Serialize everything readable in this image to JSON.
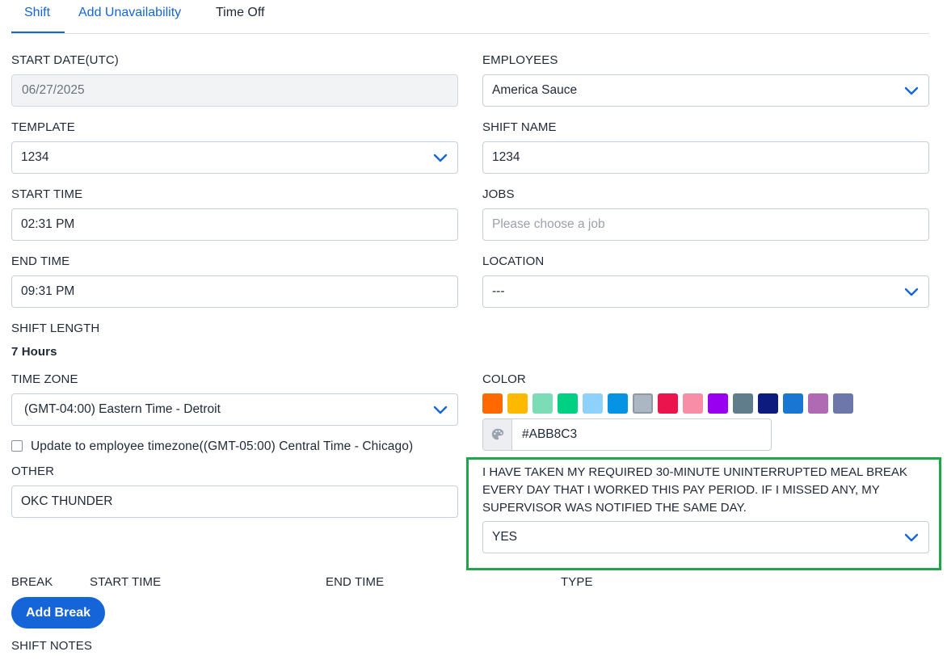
{
  "tabs": [
    {
      "label": "Shift",
      "active": true
    },
    {
      "label": "Add Unavailability",
      "active": false
    },
    {
      "label": "Time Off",
      "active": false
    }
  ],
  "form": {
    "start_date": {
      "label": "START DATE(UTC)",
      "value": "06/27/2025"
    },
    "employees": {
      "label": "EMPLOYEES",
      "value": "America Sauce"
    },
    "template": {
      "label": "TEMPLATE",
      "value": "1234"
    },
    "shift_name": {
      "label": "SHIFT NAME",
      "value": "1234"
    },
    "start_time": {
      "label": "START TIME",
      "value": "02:31 PM"
    },
    "jobs": {
      "label": "JOBS",
      "placeholder": "Please choose a job"
    },
    "end_time": {
      "label": "END TIME",
      "value": "09:31 PM"
    },
    "location": {
      "label": "LOCATION",
      "value": "---"
    },
    "shift_length": {
      "label": "SHIFT LENGTH",
      "value": "7 Hours"
    },
    "time_zone": {
      "label": "TIME ZONE",
      "value": "(GMT-04:00) Eastern Time - Detroit"
    },
    "update_timezone": {
      "label": "Update to employee timezone((GMT-05:00) Central Time - Chicago)",
      "checked": false
    },
    "color": {
      "label": "COLOR",
      "value": "#ABB8C3",
      "selected": "#ABB8C3",
      "swatches": [
        "#FF6900",
        "#FCB900",
        "#7BDCB5",
        "#00D084",
        "#8ED1FC",
        "#0693E3",
        "#ABB8C3",
        "#EB144C",
        "#F78DA7",
        "#9900EF",
        "#607D8B",
        "#0D1B7E",
        "#1976D2",
        "#B06AB3",
        "#6D77AA"
      ],
      "palette_icon": "palette-icon"
    },
    "other": {
      "label": "OTHER",
      "value": "OKC THUNDER"
    },
    "meal_break": {
      "question": "I HAVE TAKEN MY REQUIRED 30-MINUTE UNINTERRUPTED MEAL BREAK EVERY DAY THAT I WORKED THIS PAY PERIOD. IF I MISSED ANY, MY SUPERVISOR WAS NOTIFIED THE SAME DAY.",
      "value": "YES"
    },
    "breaks": {
      "label": "BREAK",
      "columns": [
        "START TIME",
        "END TIME",
        "TYPE"
      ],
      "add_button": "Add Break"
    },
    "shift_notes": {
      "label": "SHIFT NOTES"
    }
  },
  "icons": {
    "dropdown": "chevron-down-icon"
  },
  "colors": {
    "accent": "#1565D8",
    "highlight": "#1FA64A"
  }
}
